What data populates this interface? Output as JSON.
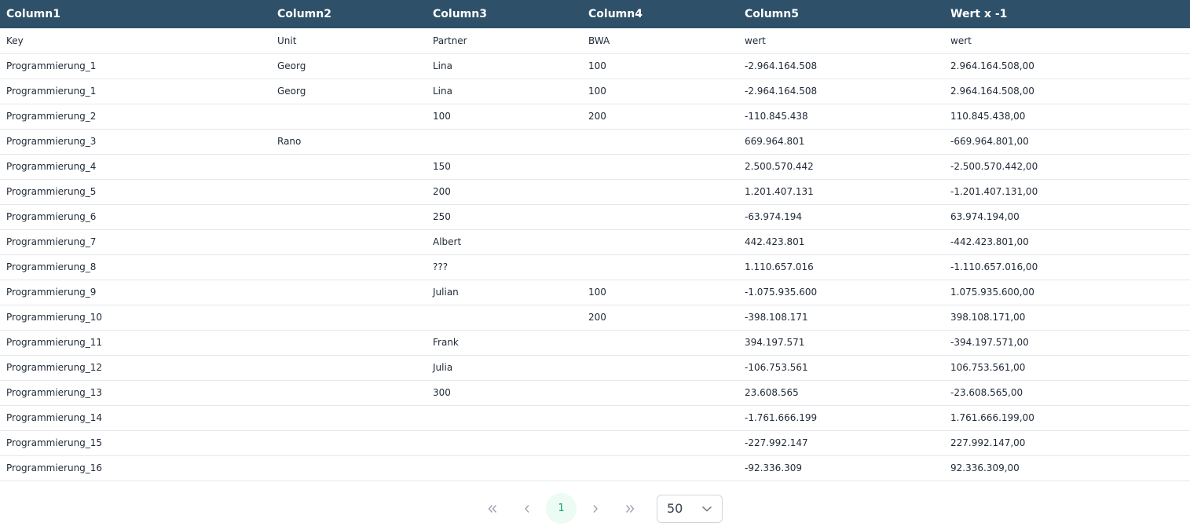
{
  "table": {
    "headers": [
      "Column1",
      "Column2",
      "Column3",
      "Column4",
      "Column5",
      "Wert x -1"
    ],
    "rows": [
      [
        "Key",
        "Unit",
        "Partner",
        "BWA",
        "wert",
        "wert"
      ],
      [
        "Programmierung_1",
        "Georg",
        "Lina",
        "100",
        "-2.964.164.508",
        "2.964.164.508,00"
      ],
      [
        "Programmierung_1",
        "Georg",
        "Lina",
        "100",
        "-2.964.164.508",
        "2.964.164.508,00"
      ],
      [
        "Programmierung_2",
        "",
        "100",
        "200",
        "-110.845.438",
        "110.845.438,00"
      ],
      [
        "Programmierung_3",
        "Rano",
        "",
        "",
        "669.964.801",
        "-669.964.801,00"
      ],
      [
        "Programmierung_4",
        "",
        "150",
        "",
        "2.500.570.442",
        "-2.500.570.442,00"
      ],
      [
        "Programmierung_5",
        "",
        "200",
        "",
        "1.201.407.131",
        "-1.201.407.131,00"
      ],
      [
        "Programmierung_6",
        "",
        "250",
        "",
        "-63.974.194",
        "63.974.194,00"
      ],
      [
        "Programmierung_7",
        "",
        "Albert",
        "",
        "442.423.801",
        "-442.423.801,00"
      ],
      [
        "Programmierung_8",
        "",
        "???",
        "",
        "1.110.657.016",
        "-1.110.657.016,00"
      ],
      [
        "Programmierung_9",
        "",
        "Julian",
        "100",
        "-1.075.935.600",
        "1.075.935.600,00"
      ],
      [
        "Programmierung_10",
        "",
        "",
        "200",
        "-398.108.171",
        "398.108.171,00"
      ],
      [
        "Programmierung_11",
        "",
        "Frank",
        "",
        "394.197.571",
        "-394.197.571,00"
      ],
      [
        "Programmierung_12",
        "",
        "Julia",
        "",
        "-106.753.561",
        "106.753.561,00"
      ],
      [
        "Programmierung_13",
        "",
        "300",
        "",
        "23.608.565",
        "-23.608.565,00"
      ],
      [
        "Programmierung_14",
        "",
        "",
        "",
        "-1.761.666.199",
        "1.761.666.199,00"
      ],
      [
        "Programmierung_15",
        "",
        "",
        "",
        "-227.992.147",
        "227.992.147,00"
      ],
      [
        "Programmierung_16",
        "",
        "",
        "",
        "-92.336.309",
        "92.336.309,00"
      ]
    ]
  },
  "pagination": {
    "current_page": "1",
    "page_size": "50",
    "icons": {
      "first": "double-chevron-left-icon",
      "prev": "chevron-left-icon",
      "next": "chevron-right-icon",
      "last": "double-chevron-right-icon",
      "dropdown": "chevron-down-icon"
    }
  },
  "colors": {
    "header_bg": "#2e5068",
    "current_page_bg": "#ecfbf3",
    "current_page_text": "#16a36a"
  }
}
